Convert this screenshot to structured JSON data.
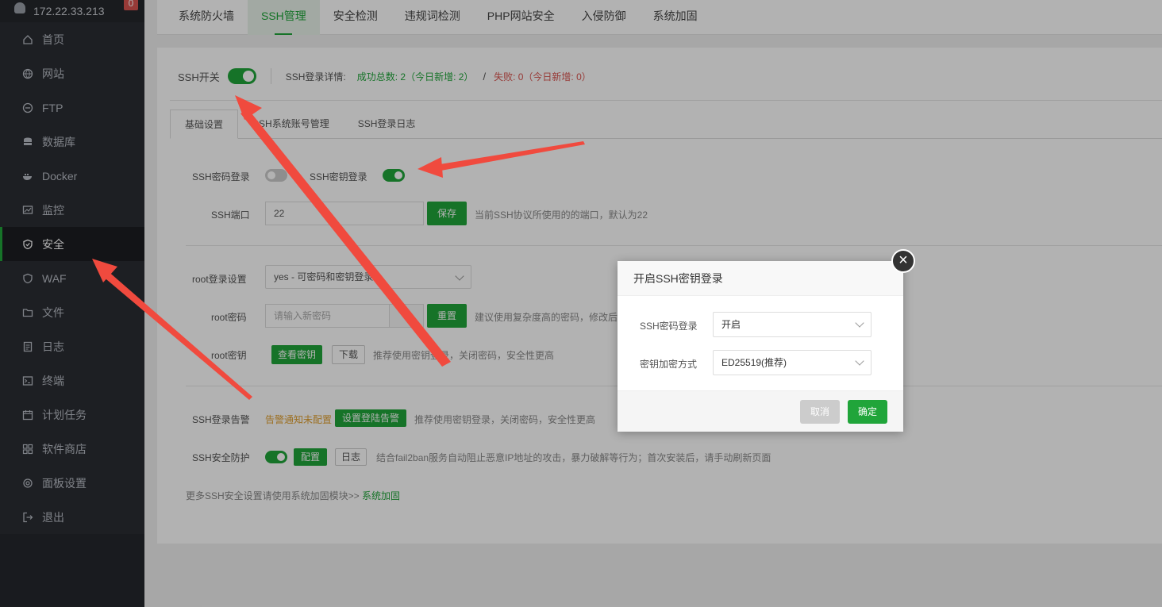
{
  "sidebar": {
    "host": "172.22.33.213",
    "badge": "0",
    "items": [
      {
        "label": "首页",
        "icon": "home-icon"
      },
      {
        "label": "网站",
        "icon": "globe-icon"
      },
      {
        "label": "FTP",
        "icon": "ftp-icon"
      },
      {
        "label": "数据库",
        "icon": "database-icon"
      },
      {
        "label": "Docker",
        "icon": "docker-icon"
      },
      {
        "label": "监控",
        "icon": "monitor-icon"
      },
      {
        "label": "安全",
        "icon": "shield-icon",
        "active": true
      },
      {
        "label": "WAF",
        "icon": "waf-icon"
      },
      {
        "label": "文件",
        "icon": "folder-icon"
      },
      {
        "label": "日志",
        "icon": "log-icon"
      },
      {
        "label": "终端",
        "icon": "terminal-icon"
      },
      {
        "label": "计划任务",
        "icon": "schedule-icon"
      },
      {
        "label": "软件商店",
        "icon": "store-icon"
      },
      {
        "label": "面板设置",
        "icon": "settings-icon"
      },
      {
        "label": "退出",
        "icon": "logout-icon"
      }
    ]
  },
  "top_tabs": [
    "系统防火墙",
    "SSH管理",
    "安全检测",
    "违规词检测",
    "PHP网站安全",
    "入侵防御",
    "系统加固"
  ],
  "ssh_head": {
    "switch_label": "SSH开关",
    "detail_label": "SSH登录详情:",
    "success": "成功总数: 2（今日新增: 2）",
    "slash": "/",
    "fail": "失败: 0（今日新增: 0）"
  },
  "sub_tabs": [
    "基础设置",
    "SSH系统账号管理",
    "SSH登录日志"
  ],
  "basic": {
    "pwd_login_label": "SSH密码登录",
    "key_login_label": "SSH密钥登录",
    "port_label": "SSH端口",
    "port_value": "22",
    "save_btn": "保存",
    "port_hint": "当前SSH协议所使用的的端口，默认为22",
    "root_login_label": "root登录设置",
    "root_login_value": "yes - 可密码和密钥登录",
    "root_pwd_label": "root密码",
    "root_pwd_placeholder": "请输入新密码",
    "reset_btn": "重置",
    "root_pwd_hint": "建议使用复杂度高的密码，修改后",
    "root_key_label": "root密钥",
    "view_key_btn": "查看密钥",
    "download_btn": "下载",
    "root_key_hint": "推荐使用密钥登录，关闭密码，安全性更高",
    "alert_label": "SSH登录告警",
    "alert_status": "告警通知未配置",
    "alert_btn": "设置登陆告警",
    "alert_hint": "推荐使用密钥登录，关闭密码，安全性更高",
    "protect_label": "SSH安全防护",
    "config_btn": "配置",
    "log_btn": "日志",
    "protect_hint": "结合fail2ban服务自动阻止恶意IP地址的攻击，暴力破解等行为；首次安装后，请手动刷新页面",
    "more_text": "更多SSH安全设置请使用系统加固模块>> ",
    "more_link": "系统加固"
  },
  "modal": {
    "title": "开启SSH密钥登录",
    "close": "×",
    "pwd_label": "SSH密码登录",
    "pwd_value": "开启",
    "enc_label": "密钥加密方式",
    "enc_value": "ED25519(推荐)",
    "cancel": "取消",
    "ok": "确定"
  },
  "colors": {
    "accent": "#20a53a",
    "danger": "#d9534f",
    "warning": "#e0a030",
    "annotation_arrow": "#f04a3e"
  }
}
